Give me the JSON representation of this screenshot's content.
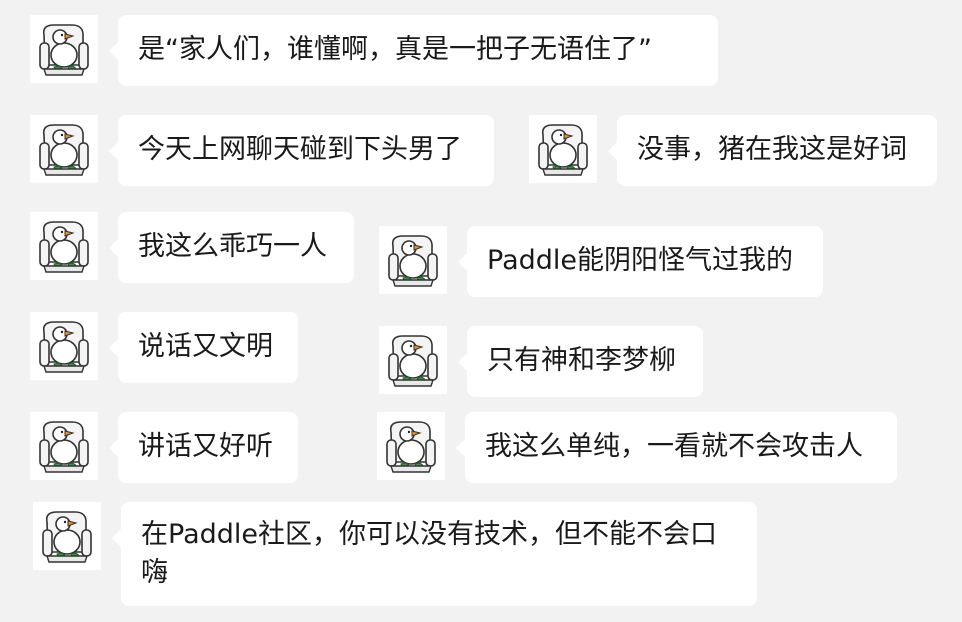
{
  "chat": {
    "messages": [
      {
        "text": "是“家人们，谁懂啊，真是一把子无语住了”",
        "avatar": "goose-on-toilet-icon"
      },
      {
        "text": "今天上网聊天碰到下头男了",
        "avatar": "goose-on-toilet-icon"
      },
      {
        "text": "没事，猪在我这是好词",
        "avatar": "goose-on-toilet-icon"
      },
      {
        "text": "我这么乖巧一人",
        "avatar": "goose-on-toilet-icon"
      },
      {
        "text": "Paddle能阴阳怪气过我的",
        "avatar": "goose-on-toilet-icon"
      },
      {
        "text": "说话又文明",
        "avatar": "goose-on-toilet-icon"
      },
      {
        "text": "只有神和李梦柳",
        "avatar": "goose-on-toilet-icon"
      },
      {
        "text": "讲话又好听",
        "avatar": "goose-on-toilet-icon"
      },
      {
        "text": "我这么单纯，一看就不会攻击人",
        "avatar": "goose-on-toilet-icon"
      },
      {
        "text": "在Paddle社区，你可以没有技术，但不能不会口嗨",
        "avatar": "goose-on-toilet-icon"
      }
    ]
  },
  "colors": {
    "background": "#f2f2f2",
    "bubble": "#ffffff",
    "text": "#1a1a1a",
    "goose_beak": "#f08c1e",
    "goose_feet": "#2e9a3e"
  }
}
